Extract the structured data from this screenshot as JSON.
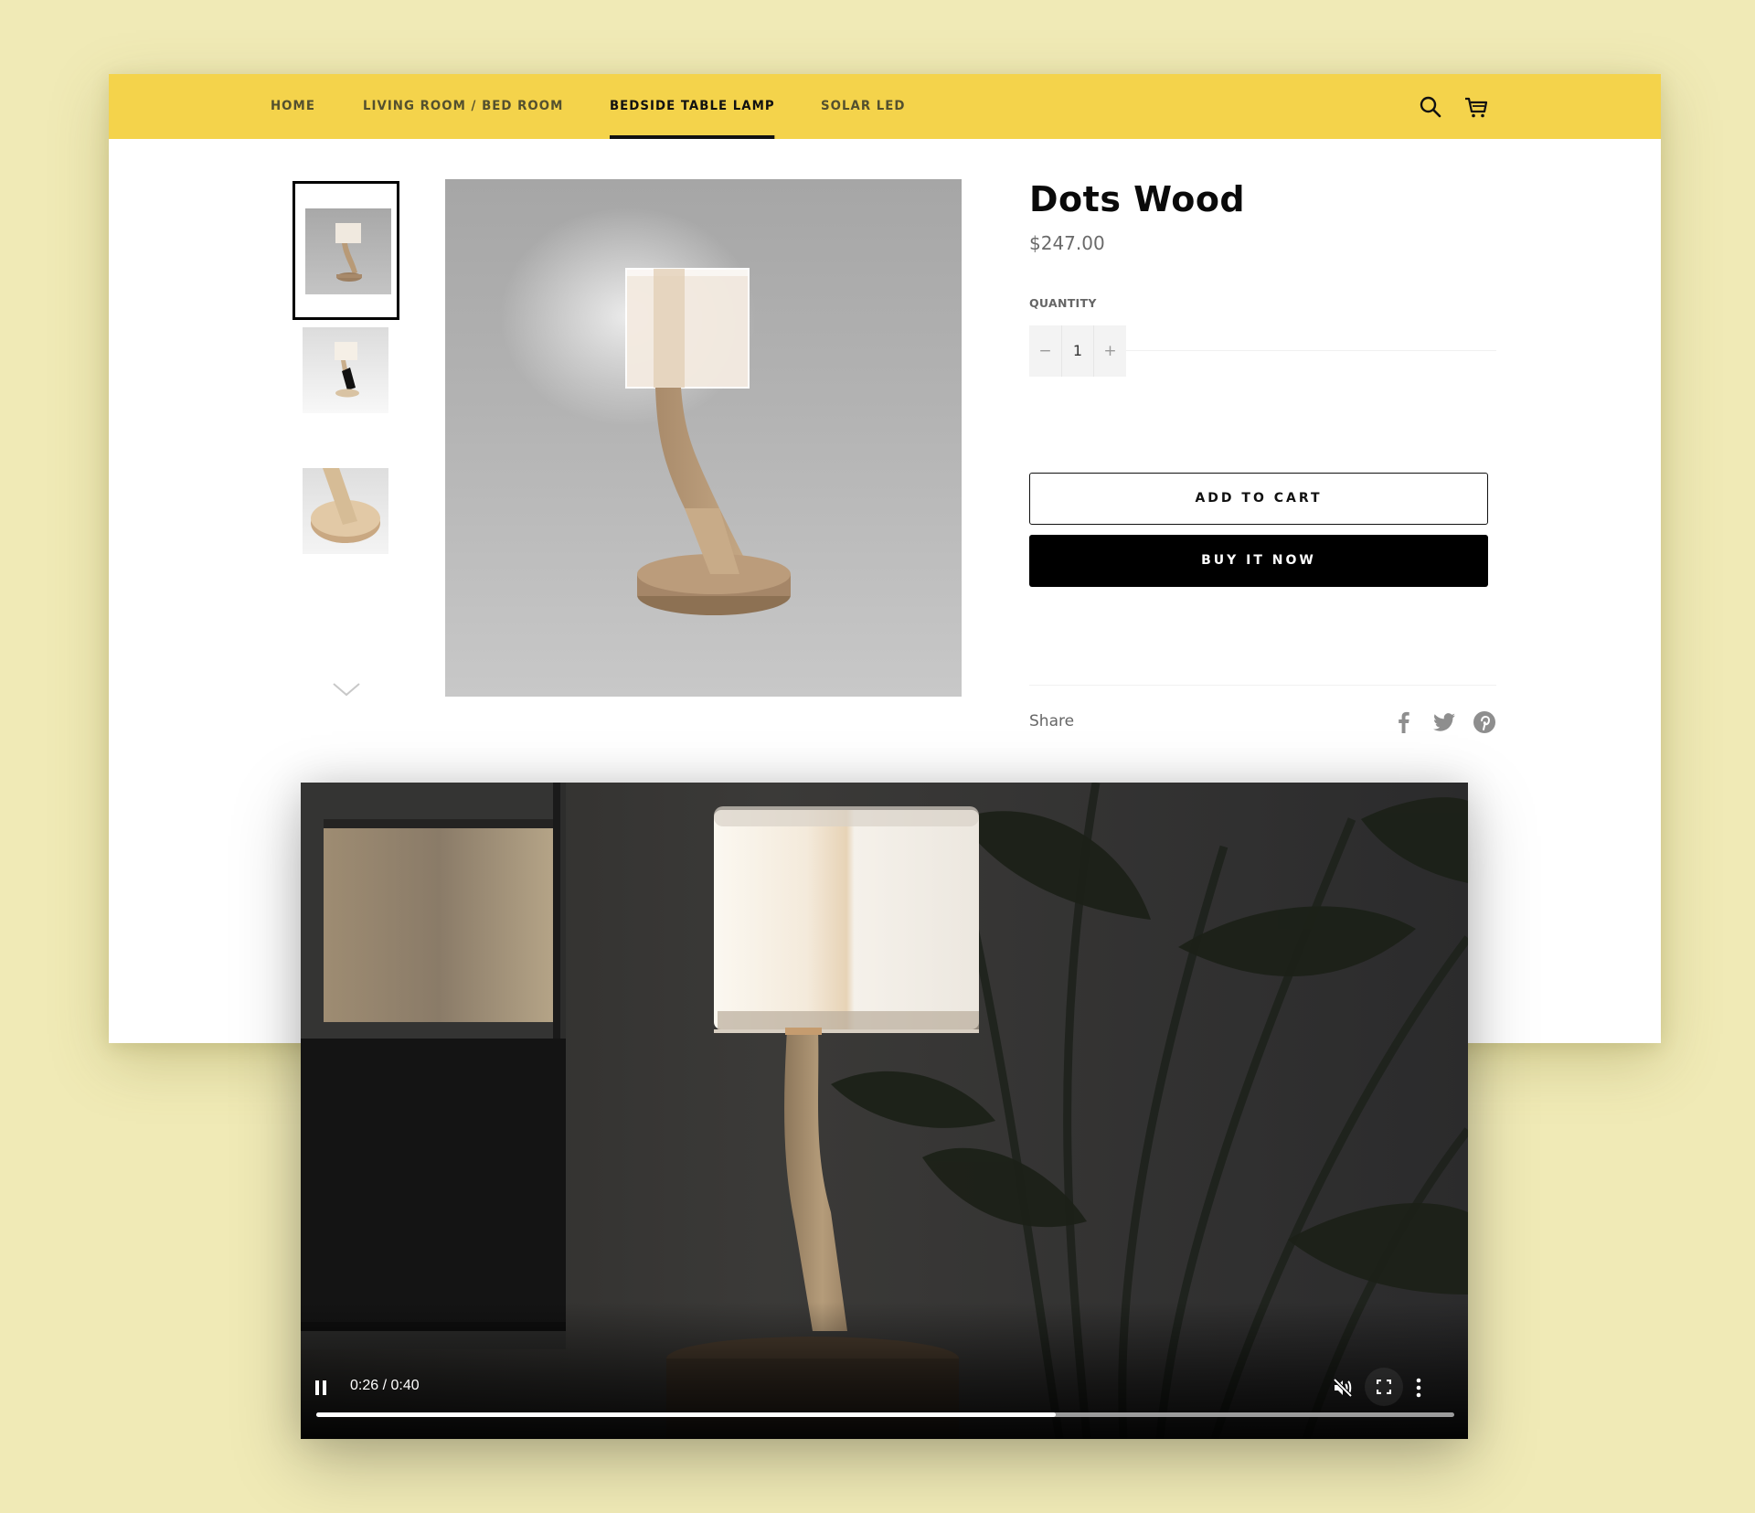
{
  "colors": {
    "background": "#f0eab6",
    "nav_bg": "#f4d34b",
    "accent": "#000000"
  },
  "nav": {
    "items": [
      {
        "label": "HOME",
        "active": false
      },
      {
        "label": "LIVING ROOM / BED ROOM",
        "active": false
      },
      {
        "label": "BEDSIDE TABLE LAMP",
        "active": true
      },
      {
        "label": "SOLAR LED",
        "active": false
      }
    ],
    "icons": [
      "search-icon",
      "cart-icon"
    ]
  },
  "gallery": {
    "thumbnails": [
      {
        "name": "lamp-front-view",
        "selected": true
      },
      {
        "name": "lamp-with-phone",
        "selected": false
      },
      {
        "name": "lamp-base-closeup",
        "selected": false
      }
    ],
    "more_icon": "chevron-down-icon"
  },
  "product": {
    "title": "Dots Wood",
    "price": "$247.00",
    "quantity_label": "QUANTITY",
    "quantity_value": "1",
    "decrement_symbol": "−",
    "increment_symbol": "+",
    "add_to_cart_label": "ADD TO CART",
    "buy_now_label": "BUY IT NOW",
    "share_label": "Share",
    "social_icons": [
      "facebook-icon",
      "twitter-icon",
      "pinterest-icon"
    ]
  },
  "video": {
    "current_time": "0:26",
    "duration": "0:40",
    "time_display": "0:26 / 0:40",
    "progress": 0.65,
    "state": "playing",
    "muted": true,
    "controls": [
      "pause-icon",
      "mute-icon",
      "fullscreen-icon",
      "more-options-icon"
    ]
  }
}
